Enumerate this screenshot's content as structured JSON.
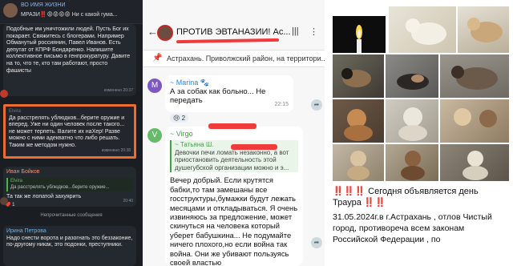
{
  "panel1": {
    "channel_name": "ВО ИМЯ ЖИЗНИ",
    "channel_sub": "МРАЗИ‼️😡😡😡😡 Ни с какой гума...",
    "msg1": "Подобные им уничтожили людей. Пусть Бог их покарает. Свяжитесь с блогерами. Например Обманутый россиянин, Павел Иванов. Есть депутат от КПРФ Бондаренко. Напишите коллективное письмо в генпрокуратуру. Давите на то, что те, кто там работают, просто фашисты",
    "msg1_time": "изменено 20:37",
    "msg2_author": "Elvira",
    "msg2": "Да расстрелять ублюдков...берите оружие и вперед. Уже ни один человек после такого... не может терпеть. Валите их наХер! Разве можно с ними адекватно что либо решать. Таким же методом нужно.",
    "msg2_time": "изменено 20:38",
    "msg3_author": "Иван Бойков",
    "msg3_quote_name": "Elvira",
    "msg3_quote": "Да расстрелять ублюдков...берите оружие...",
    "msg3": "Та так же лопатой захуярить",
    "msg3_time": "20:40",
    "separator": "Непрочитанные сообщения",
    "msg4_author": "Ирина Петрова",
    "msg4": "Надо снести ворота и разогнать это беззаконие, по-другому никак, это подонки, преступники.",
    "react_count": "1"
  },
  "panel2": {
    "back_icon": "arrow-left-icon",
    "title": "ПРОТИВ ЭВТАНАЗИИ! Ас...",
    "pinned": "Астрахань. Приволжский район, на территори...",
    "m1_author": "~ Marina 🐾",
    "m1_text": "А за собак как больно... Не передать",
    "m1_time": "22:15",
    "m1_reaction": "😢 2",
    "m2_author": "~ Virgo",
    "m2_quote_name": "~ Татьяна Ш.",
    "m2_quote": "Девочки печи ломать незаконно, а вот приостановить деятельность этой душегубской организации можно и э...",
    "m2_text": "Вечер добрый. Если крутятся бабки,то там замешаны все госструктуры,бумажки будут лежать месяцами и откладываться. Я очень извиняюсь за предложение, может скинуться на человека который уберет бабушкина... Не подумайте ничего плохого,но если война так война. Они же убивают пользуясь своей властью",
    "colors": {
      "accent_blue": "#1e88e5",
      "accent_green": "#43a047",
      "redact": "#ef3b3b"
    }
  },
  "panel3": {
    "line1": "‼️‼️‼️ Сегодня объявляется день Траура ‼️‼️",
    "line2": "31.05.2024г.в г.Астрахань , отлов Чистый город, противореча всем законам Российской Федерации , по"
  }
}
